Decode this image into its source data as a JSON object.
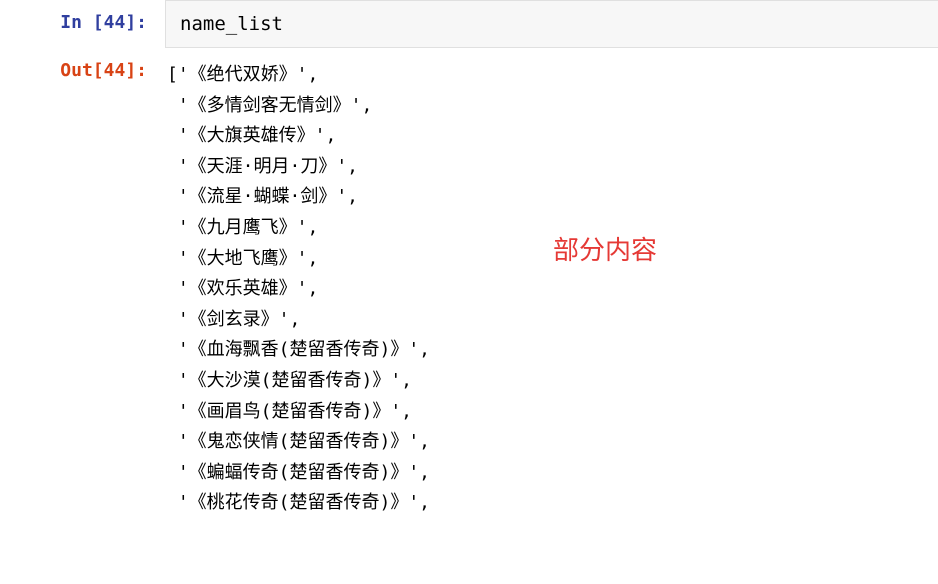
{
  "input_cell": {
    "prompt_prefix": "In [",
    "number": "44",
    "prompt_suffix": "]:",
    "code": "name_list"
  },
  "output_cell": {
    "prompt_prefix": "Out[",
    "number": "44",
    "prompt_suffix": "]:",
    "list_open": "[",
    "items": [
      "'《绝代双娇》',",
      " '《多情剑客无情剑》',",
      " '《大旗英雄传》',",
      " '《天涯·明月·刀》',",
      " '《流星·蝴蝶·剑》',",
      " '《九月鹰飞》',",
      " '《大地飞鹰》',",
      " '《欢乐英雄》',",
      " '《剑玄录》',",
      " '《血海飘香(楚留香传奇)》',",
      " '《大沙漠(楚留香传奇)》',",
      " '《画眉鸟(楚留香传奇)》',",
      " '《鬼恋侠情(楚留香传奇)》',",
      " '《蝙蝠传奇(楚留香传奇)》',",
      " '《桃花传奇(楚留香传奇)》',"
    ]
  },
  "annotation": "部分内容"
}
